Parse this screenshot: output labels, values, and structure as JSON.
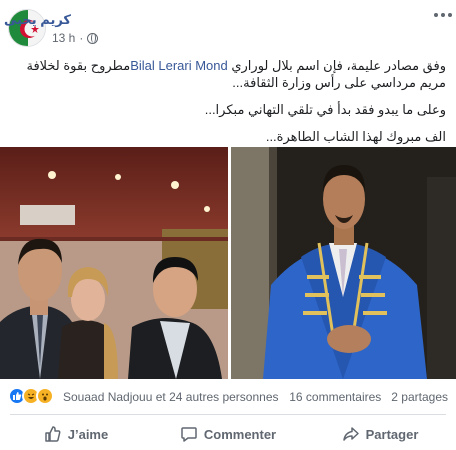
{
  "post": {
    "author": "كريم يحيى",
    "timestamp": "13 h",
    "privacy_icon": "globe-icon",
    "paragraphs": [
      {
        "before": "وفق مصادر عليمة، فإن اسم بلال لوراري ",
        "link": "Bilal Lerari Mond",
        "after": "مطروح بقوة لخلافة مريم مرداسي على رأس وزارة الثقافة..."
      },
      {
        "text": "وعلى ما يبدو فقد بدأ في تلقي التهاني مبكرا..."
      },
      {
        "text": "الف مبروك لهذا الشاب الطاهرة..."
      }
    ]
  },
  "reactions": {
    "icons": [
      "like-icon",
      "haha-icon",
      "wow-icon"
    ],
    "names": "Souaad Nadjouu et 24 autres personnes",
    "comments": "16 commentaires",
    "shares": "2 partages"
  },
  "actions": {
    "like": "J’aime",
    "comment": "Commenter",
    "share": "Partager"
  },
  "colors": {
    "link": "#385898",
    "secondary": "#606770",
    "like_blue": "#1877f2",
    "haha_yellow": "#f7b125"
  }
}
